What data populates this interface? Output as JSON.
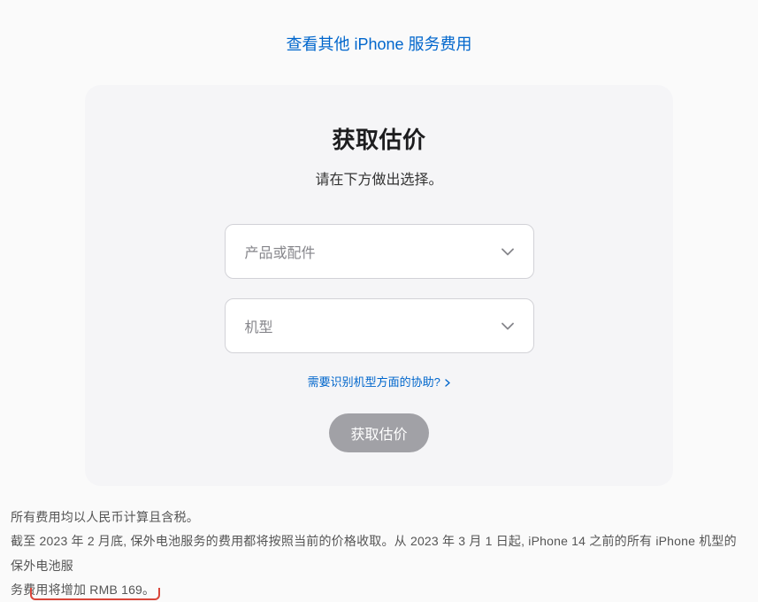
{
  "top_link": {
    "label": "查看其他 iPhone 服务费用"
  },
  "card": {
    "title": "获取估价",
    "subtitle": "请在下方做出选择。",
    "select_product": {
      "placeholder": "产品或配件"
    },
    "select_model": {
      "placeholder": "机型"
    },
    "help_link": {
      "label": "需要识别机型方面的协助?"
    },
    "submit_label": "获取估价"
  },
  "notes": {
    "line1": "所有费用均以人民币计算且含税。",
    "line2_a": "截至 2023 年 2 月底, 保外电池服务的费用都将按照当前的价格收取。从 2023 年 3 月 1 日起, iPhone 14 之前的所有 iPhone 机型的保外电池服",
    "line2_b": "务费用将增加 RMB 169。"
  }
}
